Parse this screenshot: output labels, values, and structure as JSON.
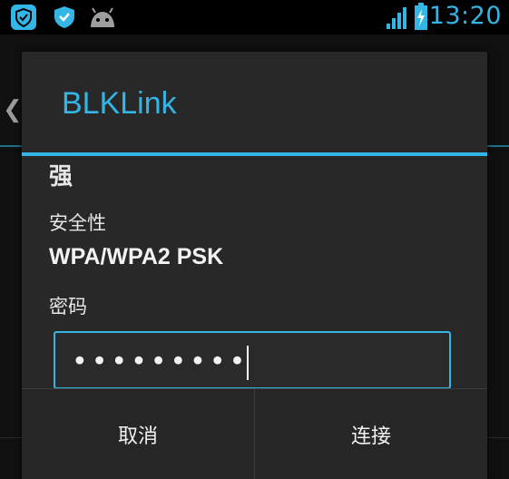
{
  "status_bar": {
    "time": "13:20",
    "icons": [
      "shield-app-icon",
      "shield-check-icon",
      "android-icon",
      "signal-icon",
      "battery-charging-icon"
    ],
    "accent_color": "#33b5e5"
  },
  "dialog": {
    "title": "BLKLink",
    "signal_strength": "强",
    "security_label": "安全性",
    "security_value": "WPA/WPA2 PSK",
    "password_label": "密码",
    "password_value": "•••••••••",
    "cancel_label": "取消",
    "connect_label": "连接"
  }
}
